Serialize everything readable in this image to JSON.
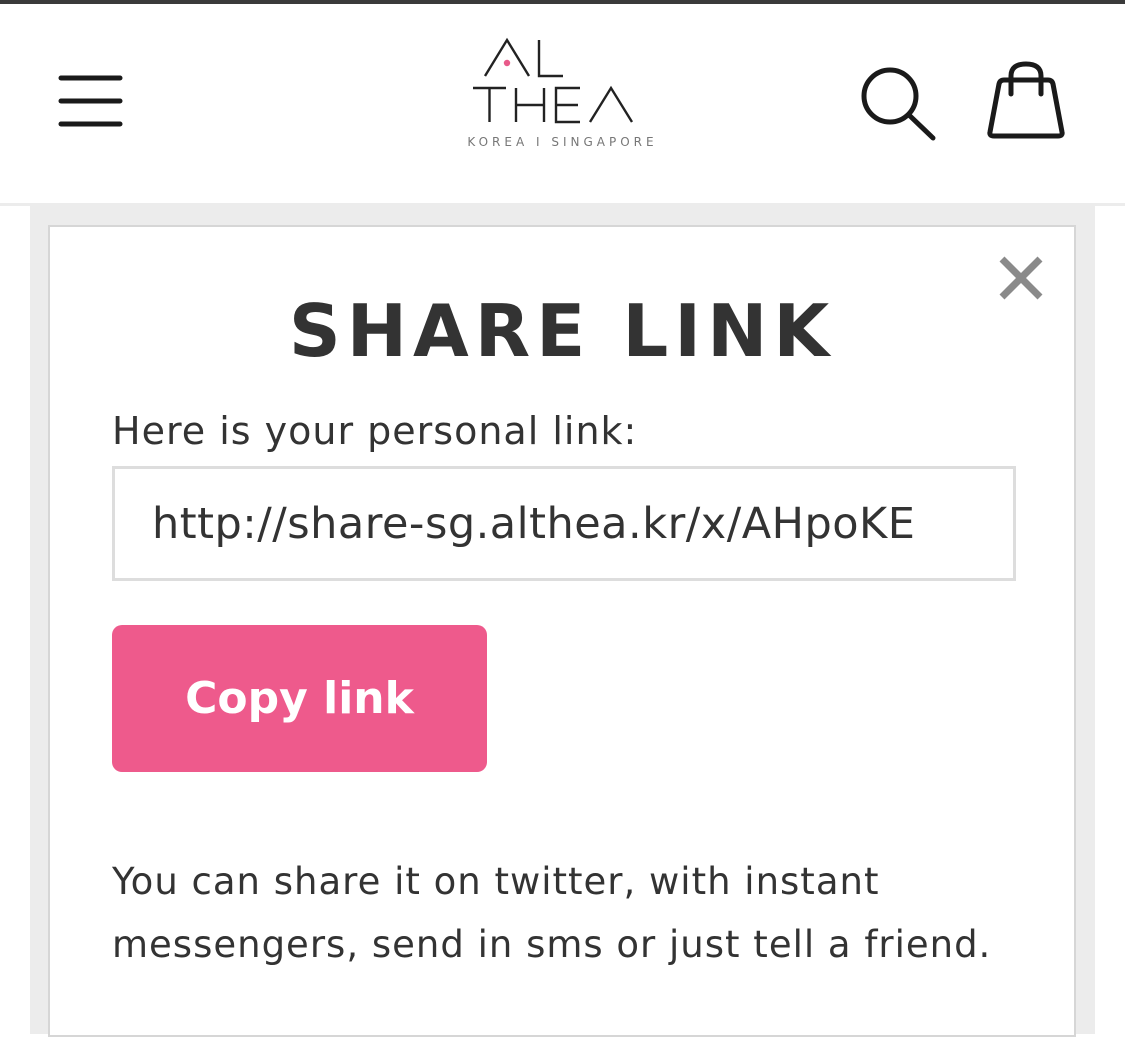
{
  "header": {
    "logo": {
      "wordmark_line1": "AL",
      "wordmark_line2": "THEA",
      "subtitle": "KOREA I SINGAPORE"
    },
    "icons": {
      "menu": "menu-icon",
      "search": "search-icon",
      "cart": "shopping-bag-icon"
    }
  },
  "modal": {
    "title": "SHARE LINK",
    "intro": "Here is your personal link:",
    "link_value": "http://share-sg.althea.kr/x/AHpoKE",
    "copy_label": "Copy link",
    "hint": "You can share it on twitter, with instant messengers, send in sms or just tell a friend.",
    "close_icon": "close-icon"
  },
  "colors": {
    "accent": "#ee5a8c",
    "text": "#333333",
    "border": "#dddddd",
    "logo_dot": "#e85a8a"
  }
}
